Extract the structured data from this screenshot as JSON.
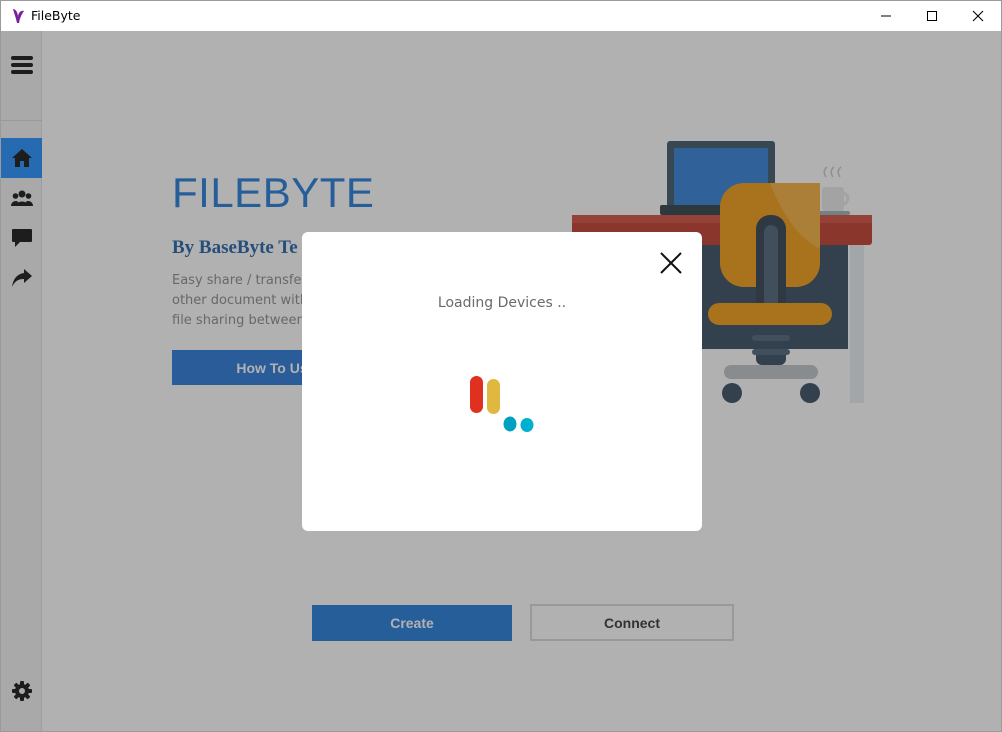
{
  "window": {
    "title": "FileByte"
  },
  "sidebar": {
    "menu_icon": "hamburger-menu-icon",
    "items": [
      {
        "name": "home",
        "icon": "home-icon",
        "active": true
      },
      {
        "name": "users",
        "icon": "users-group-icon",
        "active": false
      },
      {
        "name": "chat",
        "icon": "chat-bubble-icon",
        "active": false
      },
      {
        "name": "share",
        "icon": "share-arrow-icon",
        "active": false
      }
    ],
    "settings_icon": "gear-icon"
  },
  "main": {
    "title": "FILEBYTE",
    "subtitle": "By BaseByte Te",
    "description": [
      "Easy share / transfer f",
      "other document with",
      "file sharing between c"
    ],
    "howto_label": "How To Us",
    "create_label": "Create",
    "connect_label": "Connect"
  },
  "modal": {
    "status": "Loading Devices ..",
    "close_icon": "close-icon"
  },
  "colors": {
    "accent": "#1f7ad8",
    "active_sidebar": "#1f8fff",
    "loader_red": "#e03020",
    "loader_yellow": "#e0b840",
    "loader_teal": "#00a8c8"
  }
}
